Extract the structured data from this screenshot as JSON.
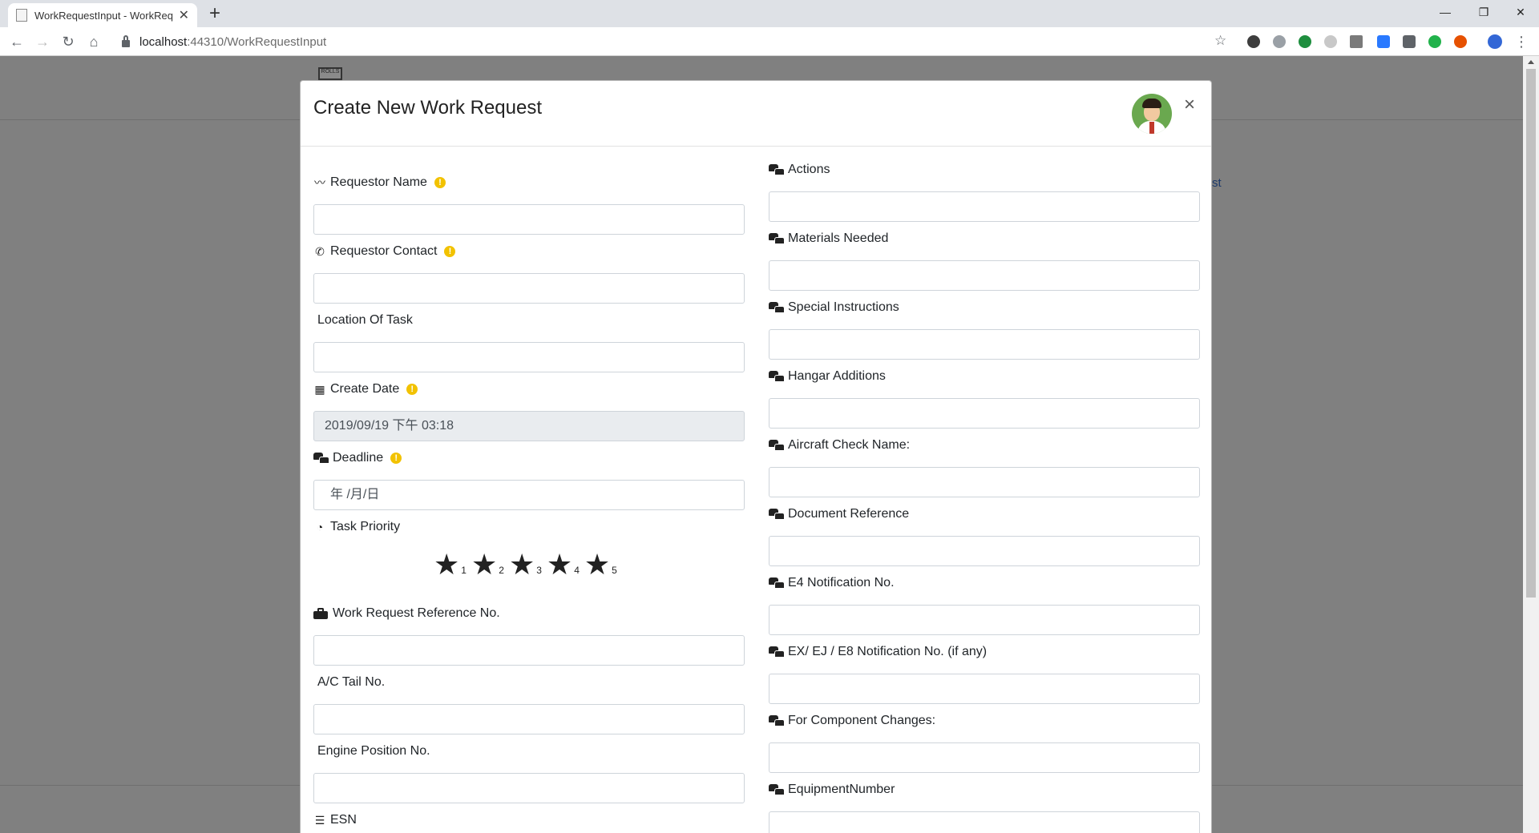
{
  "browser": {
    "tab_title": "WorkRequestInput - WorkReq",
    "new_tab": "+",
    "url_host": "localhost",
    "url_path": ":44310/WorkRequestInput",
    "minimize": "—",
    "maximize": "❐",
    "close": "✕"
  },
  "page": {
    "logo_text": "ROLLS",
    "side_link": "st"
  },
  "modal": {
    "title": "Create New Work Request",
    "close": "×",
    "left_fields": [
      {
        "label": "Requestor Name",
        "value": "",
        "icon": "signature-icon",
        "required": true
      },
      {
        "label": "Requestor Contact",
        "value": "",
        "icon": "phone-icon",
        "required": true
      },
      {
        "label": "Location Of Task",
        "value": "",
        "icon": "",
        "required": false
      },
      {
        "label": "Create Date",
        "value": "2019/09/19 下午 03:18",
        "icon": "calendar-icon",
        "required": true
      },
      {
        "label": "Deadline",
        "value": "年 /月/日",
        "icon": "cars-icon",
        "required": true
      },
      {
        "label": "Task Priority",
        "icon": "gauge-icon",
        "required": false
      },
      {
        "label": "Work Request Reference No.",
        "value": "",
        "icon": "briefcase-icon",
        "required": false
      },
      {
        "label": "A/C Tail No.",
        "value": "",
        "icon": "",
        "required": false
      },
      {
        "label": "Engine Position No.",
        "value": "",
        "icon": "",
        "required": false
      },
      {
        "label": "ESN",
        "icon": "list-icon",
        "required": false
      }
    ],
    "priority_stars": [
      "1",
      "2",
      "3",
      "4",
      "5"
    ],
    "right_fields": [
      {
        "label": "Actions",
        "value": ""
      },
      {
        "label": "Materials Needed",
        "value": ""
      },
      {
        "label": "Special Instructions",
        "value": ""
      },
      {
        "label": "Hangar Additions",
        "value": ""
      },
      {
        "label": "Aircraft Check Name:",
        "value": ""
      },
      {
        "label": "Document Reference",
        "value": ""
      },
      {
        "label": "E4 Notification No.",
        "value": ""
      },
      {
        "label": "EX/ EJ / E8 Notification No. (if any)",
        "value": ""
      },
      {
        "label": "For Component Changes:",
        "value": ""
      },
      {
        "label": "EquipmentNumber",
        "value": ""
      }
    ],
    "info_mark": "!"
  },
  "colors": {
    "info": "#f2c200",
    "overlay": "#808080"
  }
}
